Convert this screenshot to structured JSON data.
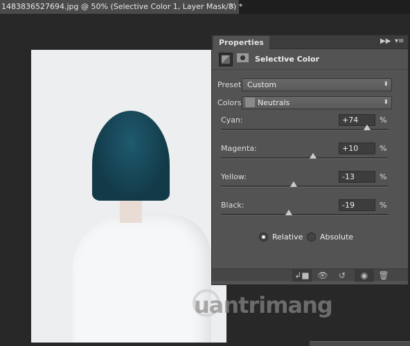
{
  "document_tab": {
    "title": "1483836527694.jpg @ 50% (Selective Color 1, Layer Mask/8) *",
    "close_icon": "close-icon"
  },
  "properties": {
    "tab_label": "Properties",
    "header_title": "Selective Color",
    "preset": {
      "label": "Preset:",
      "value": "Custom"
    },
    "colors": {
      "label": "Colors:",
      "value": "Neutrals"
    },
    "sliders": [
      {
        "label": "Cyan:",
        "value": "+74",
        "percent": 74
      },
      {
        "label": "Magenta:",
        "value": "+10",
        "percent": 10
      },
      {
        "label": "Yellow:",
        "value": "-13",
        "percent": -13
      },
      {
        "label": "Black:",
        "value": "-19",
        "percent": -19
      }
    ],
    "pct_sign": "%",
    "method": {
      "relative": "Relative",
      "absolute": "Absolute",
      "selected": "relative"
    }
  },
  "watermark": "uantrimang"
}
